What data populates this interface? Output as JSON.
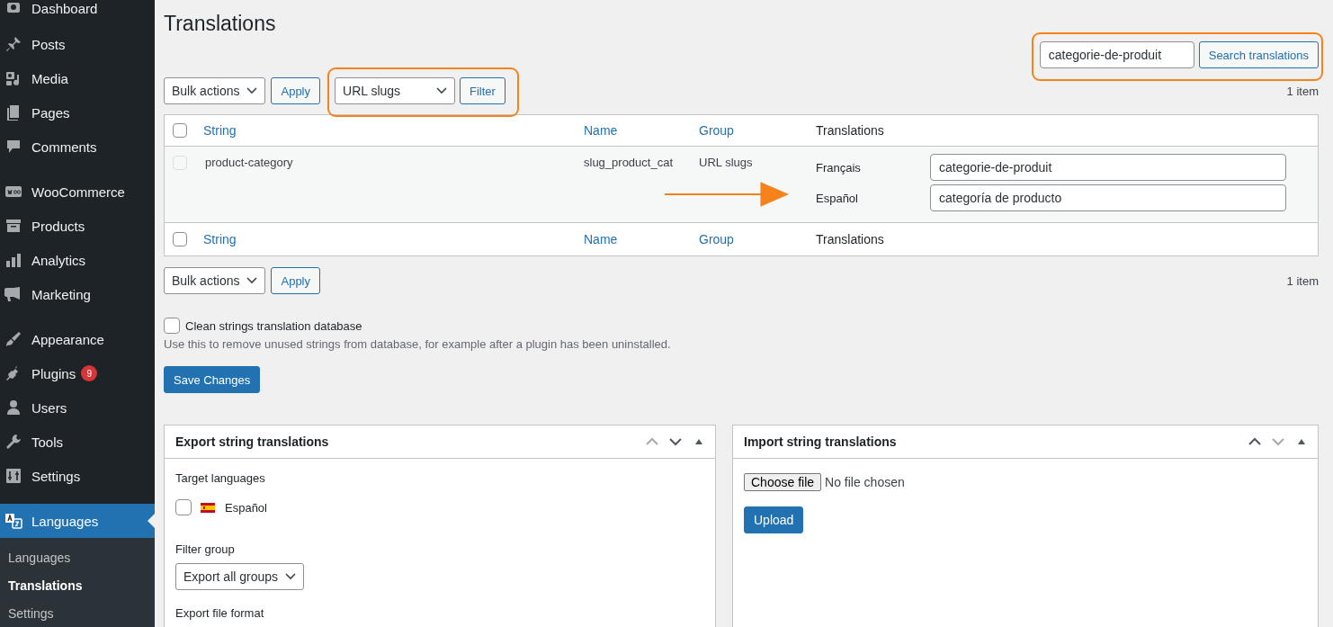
{
  "sidebar": {
    "groups": [
      [
        {
          "label": "Dashboard",
          "selected": false
        }
      ],
      [
        {
          "label": "Posts",
          "selected": false
        },
        {
          "label": "Media",
          "selected": false
        },
        {
          "label": "Pages",
          "selected": false
        },
        {
          "label": "Comments",
          "selected": false
        }
      ],
      [
        {
          "label": "WooCommerce",
          "selected": false
        },
        {
          "label": "Products",
          "selected": false
        },
        {
          "label": "Analytics",
          "selected": false
        },
        {
          "label": "Marketing",
          "selected": false
        }
      ],
      [
        {
          "label": "Appearance",
          "selected": false
        },
        {
          "label": "Plugins",
          "selected": false,
          "badge": "9"
        },
        {
          "label": "Users",
          "selected": false
        },
        {
          "label": "Tools",
          "selected": false
        },
        {
          "label": "Settings",
          "selected": false
        }
      ],
      [
        {
          "label": "Languages",
          "selected": true
        }
      ]
    ],
    "submenu": [
      {
        "label": "Languages",
        "selected": false
      },
      {
        "label": "Translations",
        "selected": true
      },
      {
        "label": "Settings",
        "selected": false
      }
    ]
  },
  "page_title": "Translations",
  "search": {
    "value": "categorie-de-produit",
    "button": "Search translations",
    "highlighted": true
  },
  "top_nav": {
    "bulk_select": "Bulk actions",
    "apply": "Apply",
    "group_select": "URL slugs",
    "filter": "Filter",
    "filter_highlighted": true,
    "count": "1 item"
  },
  "table": {
    "select_all_checked": false,
    "columns": [
      "String",
      "Name",
      "Group",
      "Translations"
    ],
    "footer_select_all_checked": false,
    "footer_columns": [
      "String",
      "Name",
      "Group",
      "Translations"
    ],
    "rows": [
      {
        "string": "product-category",
        "name": "slug_product_cat",
        "group": "URL slugs",
        "checked": false,
        "arrow": true,
        "translations": [
          {
            "language": "Français",
            "value": "categorie-de-produit"
          },
          {
            "language": "Español",
            "value": "categoría de producto"
          }
        ]
      }
    ]
  },
  "bottom_nav": {
    "bulk_select": "Bulk actions",
    "apply": "Apply",
    "count": "1 item"
  },
  "clean": {
    "label": "Clean strings translation database",
    "checked": false,
    "description": "Use this to remove unused strings from database, for example after a plugin has been uninstalled."
  },
  "save_button": "Save Changes",
  "export_box": {
    "title": "Export string translations",
    "controls": [
      {
        "kind": "up",
        "disabled": true
      },
      {
        "kind": "down",
        "disabled": false
      },
      {
        "kind": "toggle",
        "disabled": false
      }
    ],
    "target_label": "Target languages",
    "languages": [
      {
        "label": "Español",
        "checked": false
      }
    ],
    "filter_label": "Filter group",
    "filter_select": "Export all groups",
    "format_label": "Export file format"
  },
  "import_box": {
    "title": "Import string translations",
    "controls": [
      {
        "kind": "up",
        "disabled": false
      },
      {
        "kind": "down",
        "disabled": true
      },
      {
        "kind": "toggle",
        "disabled": false
      }
    ],
    "choose_button": "Choose file",
    "file_status": "No file chosen",
    "upload_button": "Upload"
  }
}
